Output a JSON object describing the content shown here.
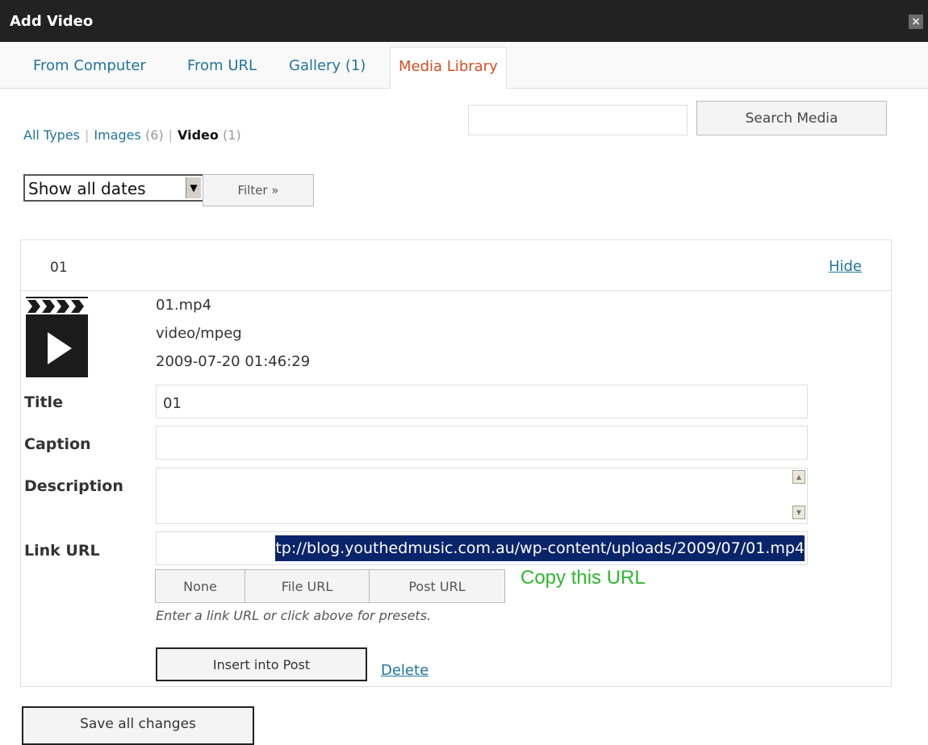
{
  "window": {
    "title": "Add Video",
    "close_glyph": "×"
  },
  "tabs": [
    {
      "label": "From Computer",
      "active": false
    },
    {
      "label": "From URL",
      "active": false
    },
    {
      "label": "Gallery (1)",
      "active": false
    },
    {
      "label": "Media Library",
      "active": true
    }
  ],
  "type_filter": {
    "all": "All Types",
    "separator": "|",
    "images_label": "Images",
    "images_count": "(6)",
    "video_label": "Video",
    "video_count": "(1)"
  },
  "search": {
    "value": "",
    "button_label": "Search Media"
  },
  "date_filter": {
    "selected": "Show all dates",
    "button_label": "Filter »"
  },
  "item": {
    "name": "01",
    "hide_label": "Hide",
    "filename": "01.mp4",
    "mime": "video/mpeg",
    "date": "2009-07-20 01:46:29",
    "thumbnail_icon": "video-clapperboard-icon",
    "fields": {
      "title_label": "Title",
      "title_value": "01",
      "caption_label": "Caption",
      "caption_value": "",
      "description_label": "Description",
      "description_value": "",
      "link_label": "Link URL",
      "link_value": "tp://blog.youthedmusic.com.au/wp-content/uploads/2009/07/01.mp4"
    },
    "presets": {
      "none": "None",
      "file": "File URL",
      "post": "Post URL"
    },
    "annotation": "Copy this URL",
    "help_text": "Enter a link URL or click above for presets.",
    "insert_label": "Insert into Post",
    "delete_label": "Delete"
  },
  "save_label": "Save all changes",
  "colors": {
    "titlebar": "#222222",
    "link": "#21759b",
    "active_tab": "#d54e21",
    "selection": "#0a246a",
    "annotation": "#2eb82e"
  }
}
